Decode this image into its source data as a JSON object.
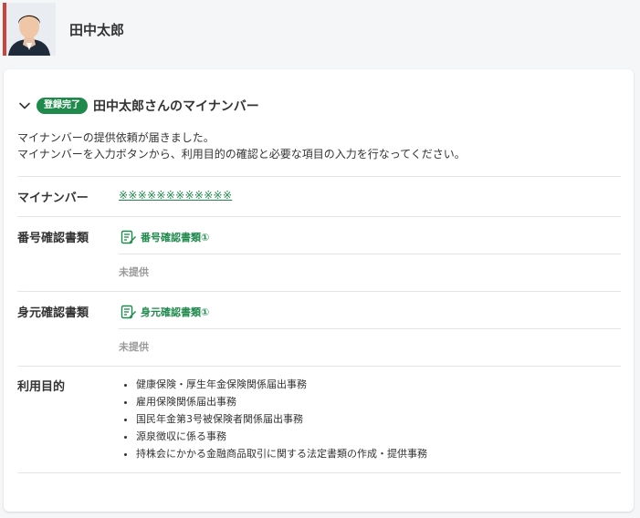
{
  "header": {
    "user_name": "田中太郎"
  },
  "section": {
    "badge": "登録完了",
    "title": "田中太郎さんのマイナンバー",
    "description_lines": [
      "マイナンバーの提供依頼が届きました。",
      "マイナンバーを入力ボタンから、利用目的の確認と必要な項目の入力を行なってください。"
    ]
  },
  "fields": {
    "mynumber": {
      "label": "マイナンバー",
      "value": "※※※※※※※※※※※※"
    },
    "number_doc": {
      "label": "番号確認書類",
      "link": "番号確認書類①",
      "status": "未提供"
    },
    "identity_doc": {
      "label": "身元確認書類",
      "link": "身元確認書類①",
      "status": "未提供"
    },
    "purpose": {
      "label": "利用目的",
      "items": [
        "健康保険・厚生年金保険関係届出事務",
        "雇用保険関係届出事務",
        "国民年金第3号被保険者関係届出事務",
        "源泉徴収に係る事務",
        "持株会にかかる金融商品取引に関する法定書類の作成・提供事務"
      ]
    }
  },
  "icons": {
    "avatar": "avatar",
    "chevron": "chevron-down-icon",
    "doc": "document-edit-icon"
  },
  "colors": {
    "accent": "#1e8a4c",
    "muted": "#9a9a9a",
    "divider": "#e2e4e6"
  }
}
